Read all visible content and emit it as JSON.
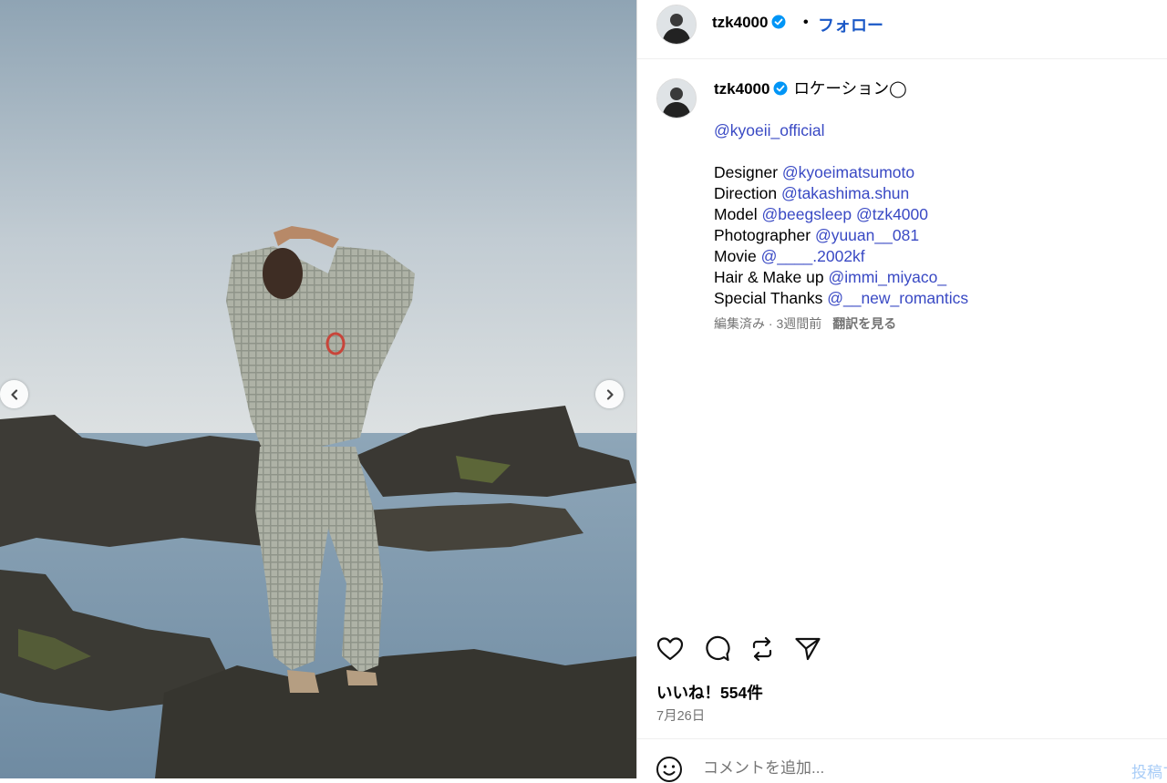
{
  "post": {
    "username": "tzk4000",
    "separator": "•",
    "follow_label": "フォロー",
    "caption": {
      "first_line_text": "ロケーション◯",
      "brand_mention": "@kyoeii_official",
      "credits": [
        {
          "role": "Designer",
          "handle": "@kyoeimatsumoto"
        },
        {
          "role": "Direction",
          "handle": "@takashima.shun"
        },
        {
          "role": "Model",
          "handle": "@beegsleep @tzk4000"
        },
        {
          "role": "Photographer",
          "handle": "@yuuan__081"
        },
        {
          "role": "Movie",
          "handle": "@____.2002kf"
        },
        {
          "role": "Hair & Make up",
          "handle": "@immi_miyaco_"
        },
        {
          "role": "Special Thanks",
          "handle": "@__new_romantics"
        }
      ],
      "meta": "編集済み · 3週間前",
      "translate_label": "翻訳を見る"
    },
    "likes": "いいね！554件",
    "date": "7月26日",
    "comment_placeholder": "コメントを追加...",
    "post_button_label": "投稿する"
  },
  "icons": {
    "verified": "verified-badge-icon",
    "prev": "chevron-left-icon",
    "next": "chevron-right-icon",
    "like": "heart-icon",
    "comment": "comment-bubble-icon",
    "repost": "repost-icon",
    "share": "send-icon",
    "emoji": "smiley-icon"
  },
  "colors": {
    "link": "#3949c4",
    "verified": "#0095f6",
    "follow": "#1a58c7",
    "muted": "#737373"
  }
}
